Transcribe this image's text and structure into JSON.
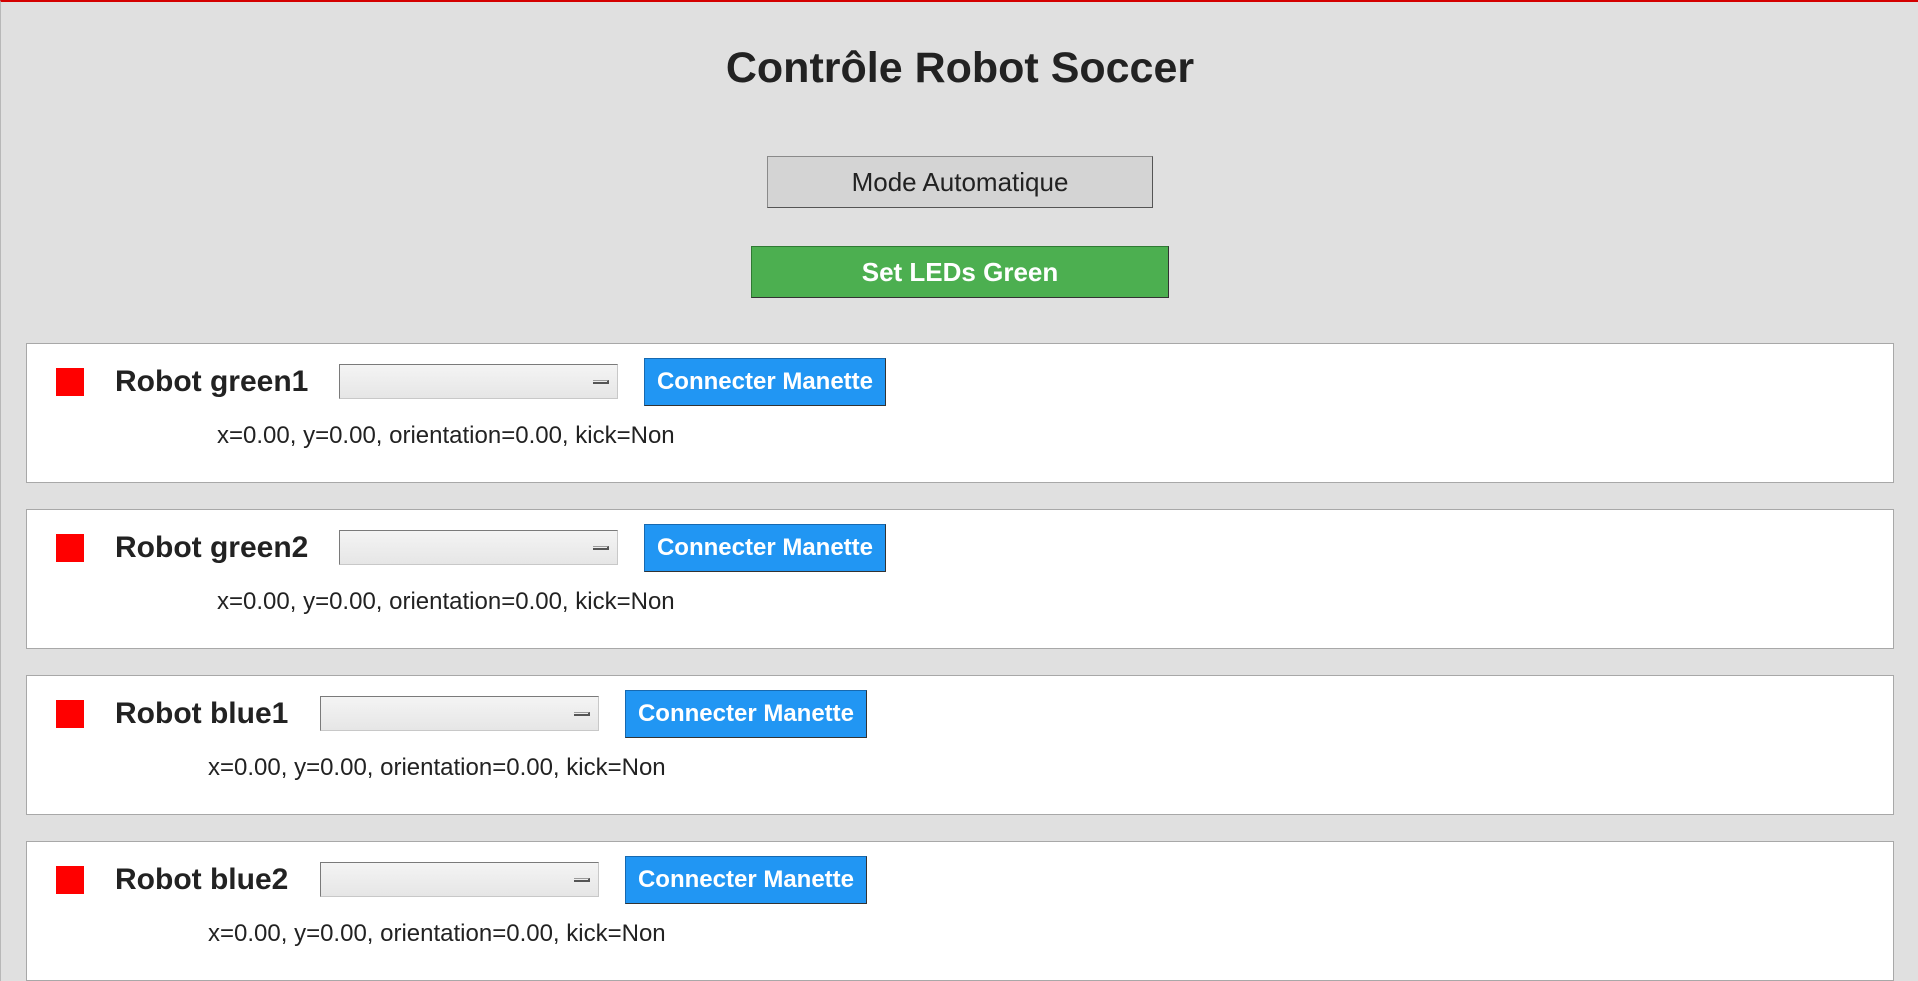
{
  "app": {
    "title": "Contrôle Robot Soccer"
  },
  "controls": {
    "mode_button_label": "Mode Automatique",
    "led_button_label": "Set LEDs Green"
  },
  "colors": {
    "window_background": "#e0e0e0",
    "accent_border": "#d40000",
    "led_button": "#4caf50",
    "connect_button": "#2196f3",
    "status_indicator": "#ff0000",
    "panel_background": "#ffffff"
  },
  "robots": [
    {
      "name": "Robot green1",
      "controller_selected": "",
      "connect_label": "Connecter Manette",
      "info": "x=0.00, y=0.00, orientation=0.00, kick=Non",
      "status_color": "#ff0000"
    },
    {
      "name": "Robot green2",
      "controller_selected": "",
      "connect_label": "Connecter Manette",
      "info": "x=0.00, y=0.00, orientation=0.00, kick=Non",
      "status_color": "#ff0000"
    },
    {
      "name": "Robot blue1",
      "controller_selected": "",
      "connect_label": "Connecter Manette",
      "info": "x=0.00, y=0.00, orientation=0.00, kick=Non",
      "status_color": "#ff0000"
    },
    {
      "name": "Robot blue2",
      "controller_selected": "",
      "connect_label": "Connecter Manette",
      "info": "x=0.00, y=0.00, orientation=0.00, kick=Non",
      "status_color": "#ff0000"
    }
  ]
}
